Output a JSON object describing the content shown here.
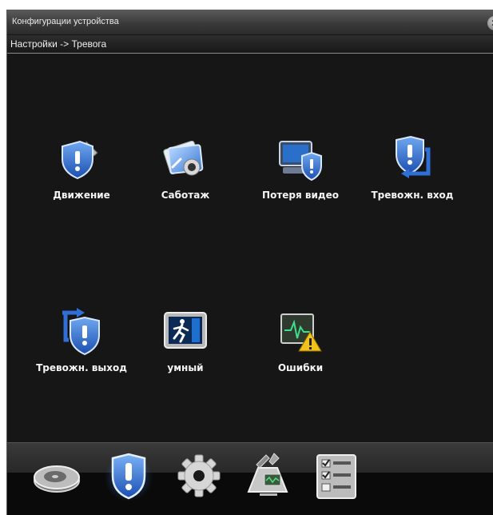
{
  "window": {
    "title": "Конфигурации устройства",
    "close_glyph": "✕"
  },
  "breadcrumb": "Настройки -> Тревога",
  "tiles": [
    {
      "label": "Движение",
      "icon": "shield-wrench-icon"
    },
    {
      "label": "Саботаж",
      "icon": "camera-tamper-icon"
    },
    {
      "label": "Потеря видео",
      "icon": "video-loss-shield-icon"
    },
    {
      "label": "Тревожн. вход",
      "icon": "shield-arrow-in-icon"
    },
    {
      "label": "Тревожн. выход",
      "icon": "shield-arrow-out-icon"
    },
    {
      "label": "умный",
      "icon": "exit-running-man-icon"
    },
    {
      "label": "Ошибки",
      "icon": "error-warning-monitor-icon"
    }
  ],
  "dock": [
    {
      "icon": "hard-disk-icon"
    },
    {
      "icon": "alarm-shield-icon",
      "selected": true
    },
    {
      "icon": "gear-icon"
    },
    {
      "icon": "system-tools-icon"
    },
    {
      "icon": "checklist-icon"
    }
  ],
  "colors": {
    "accent": "#2f6fd6",
    "background": "#161616",
    "warning": "#f2c21a"
  }
}
